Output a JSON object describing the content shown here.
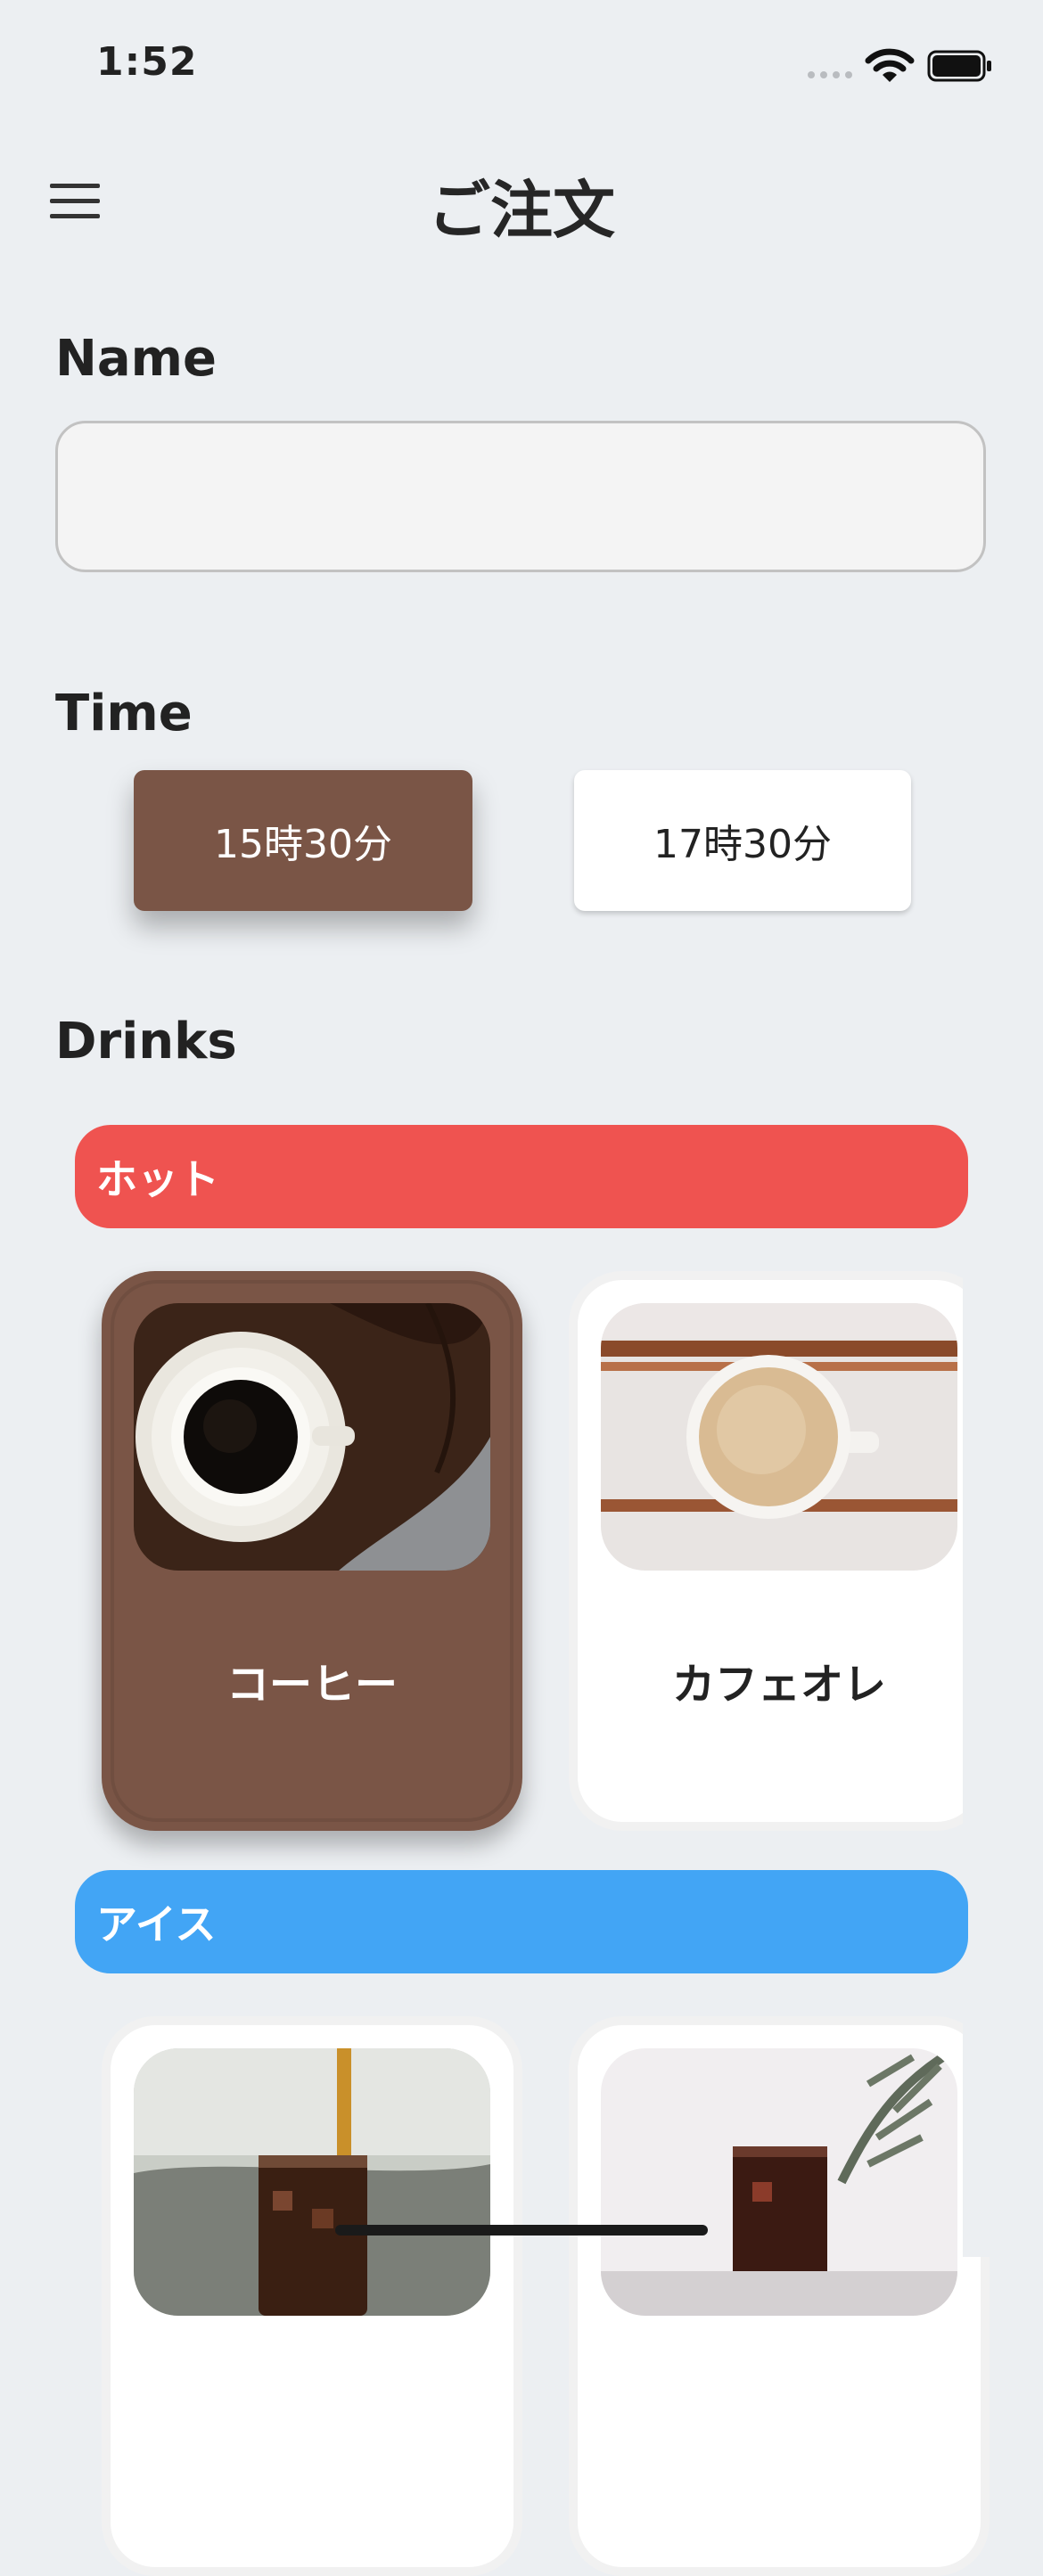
{
  "status_bar": {
    "time": "1:52"
  },
  "header": {
    "title": "ご注文"
  },
  "name_section": {
    "label": "Name",
    "value": "",
    "placeholder": ""
  },
  "time_section": {
    "label": "Time",
    "options": [
      {
        "label": "15時30分",
        "selected": true
      },
      {
        "label": "17時30分",
        "selected": false
      }
    ]
  },
  "drinks_section": {
    "label": "Drinks",
    "categories": [
      {
        "name": "ホット",
        "color": "#ef5350",
        "items": [
          {
            "name": "コーヒー",
            "selected": true,
            "image": "coffee-cup-image"
          },
          {
            "name": "カフェオレ",
            "selected": false,
            "image": "cafe-au-lait-image"
          }
        ]
      },
      {
        "name": "アイス",
        "color": "#42a5f5",
        "items": [
          {
            "name": "",
            "selected": false,
            "image": "iced-coffee-pour-image"
          },
          {
            "name": "",
            "selected": false,
            "image": "iced-drink-palm-image"
          }
        ]
      }
    ]
  },
  "colors": {
    "background": "#eceff2",
    "selected_brown": "#7a5546",
    "hot_red": "#ef5350",
    "ice_blue": "#42a5f5"
  }
}
